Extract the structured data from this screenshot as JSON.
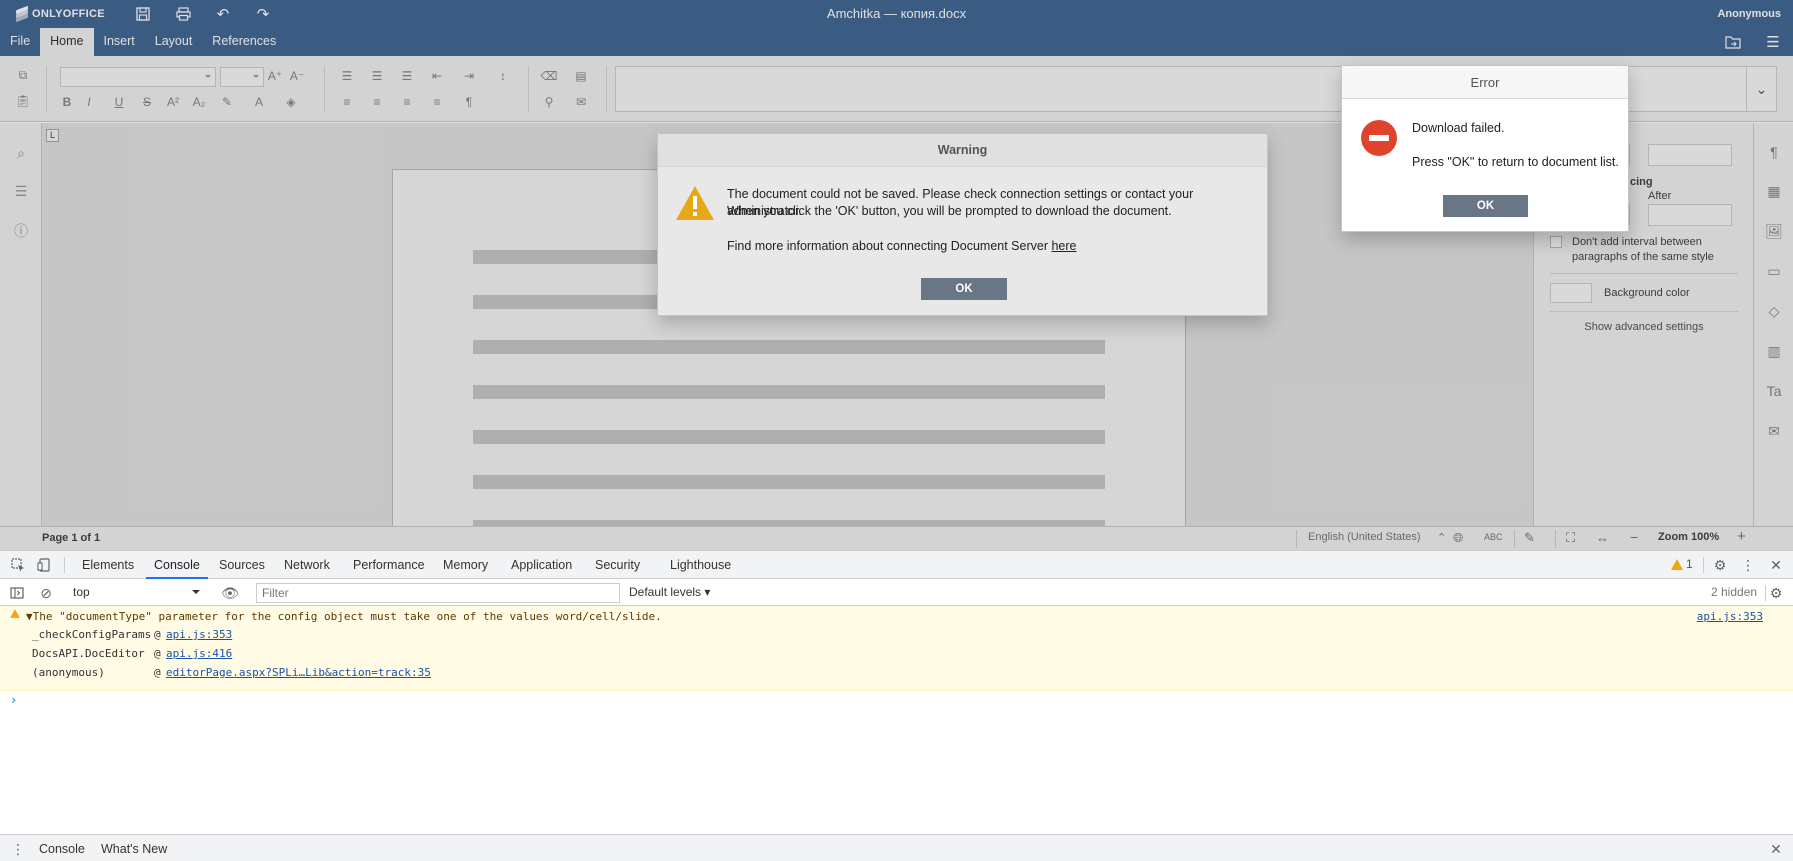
{
  "app": {
    "brand": "ONLYOFFICE",
    "title": "Amchitka — копия.docx",
    "user": "Anonymous",
    "tabs": [
      "File",
      "Home",
      "Insert",
      "Layout",
      "References"
    ],
    "active_tab": "Home",
    "accent": "#446995"
  },
  "document": {
    "page_status": "Page 1 of 1",
    "language": "English (United States)",
    "zoom": "Zoom 100%"
  },
  "paragraph_settings": {
    "spacing_label": "cing",
    "after_label": "After",
    "dont_add_interval": "Don't add interval between paragraphs of the same style",
    "background_color": "Background color",
    "show_advanced": "Show advanced settings"
  },
  "warning_dialog": {
    "title": "Warning",
    "line1": "The document could not be saved. Please check connection settings or contact your administrator.",
    "line2": "When you click the 'OK' button, you will be prompted to download the document.",
    "line3_prefix": "Find more information about connecting Document Server ",
    "line3_link": "here",
    "ok": "OK"
  },
  "error_dialog": {
    "title": "Error",
    "message": "Download failed.",
    "hint": "Press \"OK\" to return to document list.",
    "ok": "OK"
  },
  "devtools": {
    "tabs": [
      "Elements",
      "Console",
      "Sources",
      "Network",
      "Performance",
      "Memory",
      "Application",
      "Security",
      "Lighthouse"
    ],
    "active_tab": "Console",
    "warning_count": "1",
    "context": "top",
    "filter_placeholder": "Filter",
    "levels": "Default levels",
    "hidden": "2 hidden",
    "warning": {
      "message": "▼The \"documentType\" parameter for the config object must take one of the values word/cell/slide.",
      "source": "api.js:353",
      "stack": [
        {
          "fn": "_checkConfigParams",
          "link": "api.js:353"
        },
        {
          "fn": "DocsAPI.DocEditor",
          "link": "api.js:416"
        },
        {
          "fn": "(anonymous)",
          "link": "editorPage.aspx?SPLi…Lib&action=track:35"
        }
      ]
    },
    "prompt": "›",
    "drawer_tabs": [
      "Console",
      "What's New"
    ]
  }
}
